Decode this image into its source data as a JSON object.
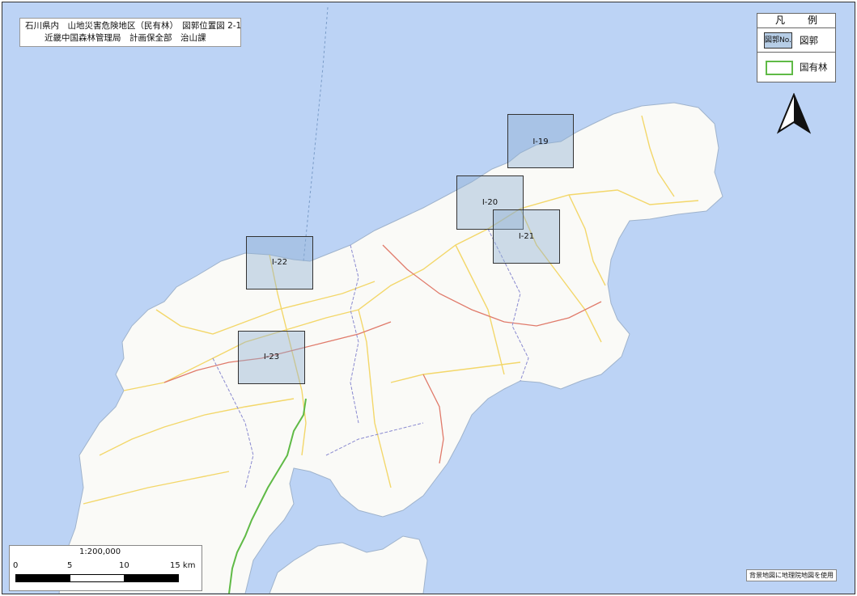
{
  "title": {
    "line1": "石川県内　山地災害危険地区（民有林）　図郭位置図 2-1",
    "line2": "近畿中国森林管理局　計画保全部　治山課"
  },
  "legend": {
    "head_left": "凡",
    "head_right": "例",
    "sheet_swatch": "図郭No.",
    "sheet_label": "図郭",
    "forest_label": "国有林",
    "forest_color": "#5fba46"
  },
  "compass_icon": "north-arrow-icon",
  "sheets": [
    {
      "id": "I-19"
    },
    {
      "id": "I-20"
    },
    {
      "id": "I-21"
    },
    {
      "id": "I-22"
    },
    {
      "id": "I-23"
    }
  ],
  "scale": {
    "ratio": "1:200,000",
    "ticks": [
      "0",
      "5",
      "10",
      "15 km"
    ]
  },
  "credit": "背景地図に地理院地図を使用",
  "colors": {
    "sea": "#bcd3f5",
    "land": "#fafaf7",
    "road_yellow": "#f3d76a",
    "road_red": "#e07a6a",
    "boundary": "#8a8ad0",
    "sheet_fill": "#8cafd2"
  }
}
